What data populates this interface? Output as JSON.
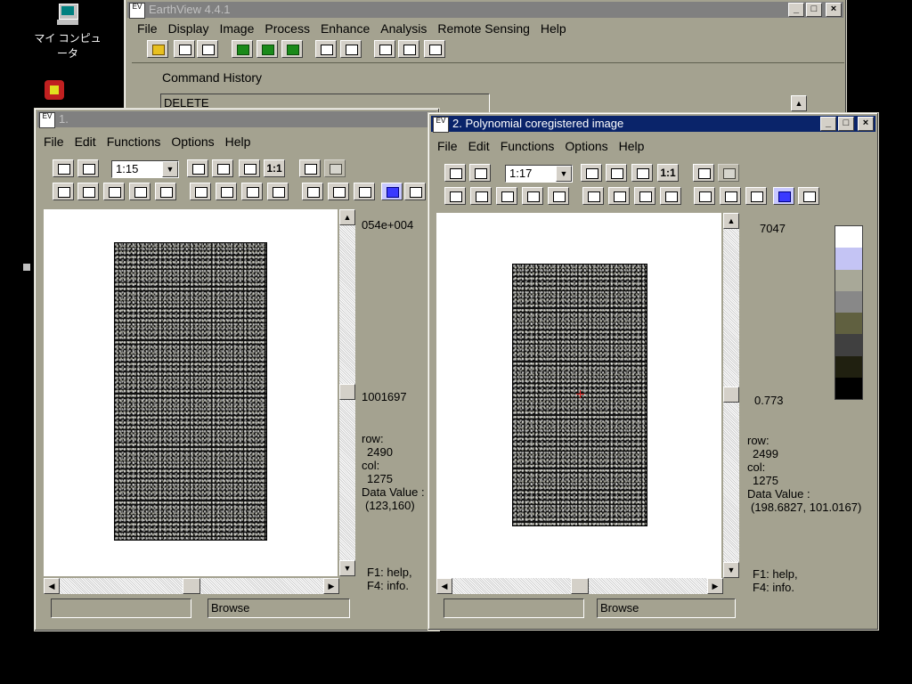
{
  "desktop": {
    "my_computer_label": "マイ コンピュータ"
  },
  "main_window": {
    "title": "EarthView 4.4.1",
    "menu": [
      "File",
      "Display",
      "Image",
      "Process",
      "Enhance",
      "Analysis",
      "Remote Sensing",
      "Help"
    ],
    "command_history_label": "Command History",
    "command_history_value": "DELETE"
  },
  "window1": {
    "title": "1.",
    "menu": [
      "File",
      "Edit",
      "Functions",
      "Options",
      "Help"
    ],
    "zoom": "1:15",
    "scale_top": "054e+004",
    "scale_bottom": "1001697",
    "row_label": "row:",
    "row_value": "2490",
    "col_label": "col:",
    "col_value": "1275",
    "data_value_label": "Data Value :",
    "data_value": "(123,160)",
    "help1": "F1: help,",
    "help2": "F4: info.",
    "status_right": "Browse",
    "status_left": ""
  },
  "window2": {
    "title": "2. Polynomial coregistered image",
    "menu": [
      "File",
      "Edit",
      "Functions",
      "Options",
      "Help"
    ],
    "zoom": "1:17",
    "scale_top": "7047",
    "scale_bottom": "0.773",
    "row_label": "row:",
    "row_value": "2499",
    "col_label": "col:",
    "col_value": "1275",
    "data_value_label": "Data Value :",
    "data_value": "(198.6827, 101.0167)",
    "help1": "F1: help,",
    "help2": "F4: info.",
    "status_right": "Browse",
    "status_left": "",
    "color_scale": [
      "#ffffff",
      "#c4c4f4",
      "#a8a898",
      "#888888",
      "#606040",
      "#404040",
      "#202010",
      "#000000"
    ]
  },
  "toolbar_label_one_to_one": "1:1"
}
